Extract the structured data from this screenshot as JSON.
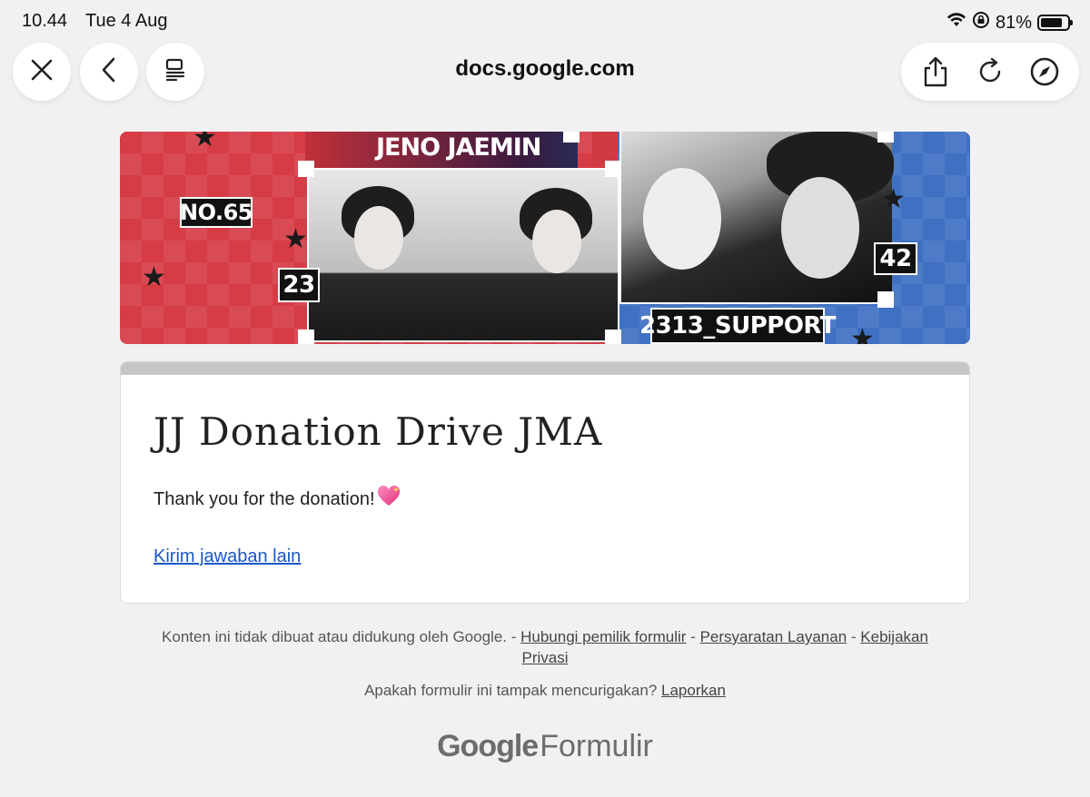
{
  "status_bar": {
    "time": "10.44",
    "date": "Tue 4 Aug",
    "battery_percent": "81%",
    "battery_level": 0.81,
    "icons": [
      "wifi-icon",
      "rotation-lock-icon",
      "battery-icon"
    ]
  },
  "browser": {
    "url": "docs.google.com",
    "left_buttons": [
      "close-icon",
      "back-icon",
      "tabs-overview-icon"
    ],
    "right_buttons": [
      "share-icon",
      "reload-icon",
      "compass-icon"
    ]
  },
  "banner": {
    "title": "JENO JAEMIN",
    "tag_no": "NO.65",
    "tag_23": "23",
    "tag_42": "42",
    "tag_support": "2313_SUPPORT",
    "colors": {
      "left": "#d63c45",
      "right": "#3f70c2"
    }
  },
  "form": {
    "title": "JJ Donation Drive JMA",
    "message": "Thank you for the donation!",
    "message_emoji": "sparkling-heart-icon",
    "another_response": "Kirim jawaban lain"
  },
  "footer": {
    "disclaimer": "Konten ini tidak dibuat atau didukung oleh Google. - ",
    "contact_owner": "Hubungi pemilik formulir",
    "sep1": " - ",
    "terms": "Persyaratan Layanan",
    "sep2": " - ",
    "privacy": "Kebijakan Privasi",
    "suspicious": "Apakah formulir ini tampak mencurigakan? ",
    "report": "Laporkan",
    "brand_google": "Google",
    "brand_forms": "Formulir"
  }
}
